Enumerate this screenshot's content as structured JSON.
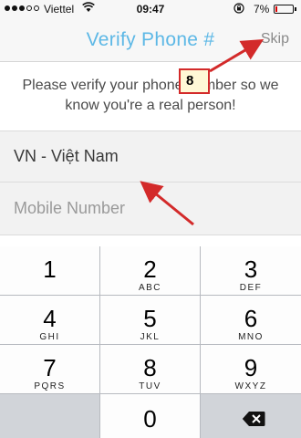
{
  "status_bar": {
    "carrier": "Viettel",
    "time": "09:47",
    "battery": "7%"
  },
  "nav": {
    "title": "Verify Phone #",
    "skip_label": "Skip"
  },
  "instruction": "Please verify your phone number so we know you're a real person!",
  "country": "VN - Việt Nam",
  "mobile": {
    "placeholder": "Mobile Number",
    "value": ""
  },
  "keypad": [
    {
      "num": "1",
      "letters": ""
    },
    {
      "num": "2",
      "letters": "ABC"
    },
    {
      "num": "3",
      "letters": "DEF"
    },
    {
      "num": "4",
      "letters": "GHI"
    },
    {
      "num": "5",
      "letters": "JKL"
    },
    {
      "num": "6",
      "letters": "MNO"
    },
    {
      "num": "7",
      "letters": "PQRS"
    },
    {
      "num": "8",
      "letters": "TUV"
    },
    {
      "num": "9",
      "letters": "WXYZ"
    },
    {
      "num": "0",
      "letters": ""
    }
  ],
  "annotation": {
    "step_label": "8",
    "color": "#d32a2a"
  },
  "colors": {
    "accent": "#5db8e6",
    "field_bg": "#f2f2f2",
    "keypad_bg": "#d1d4d9"
  }
}
